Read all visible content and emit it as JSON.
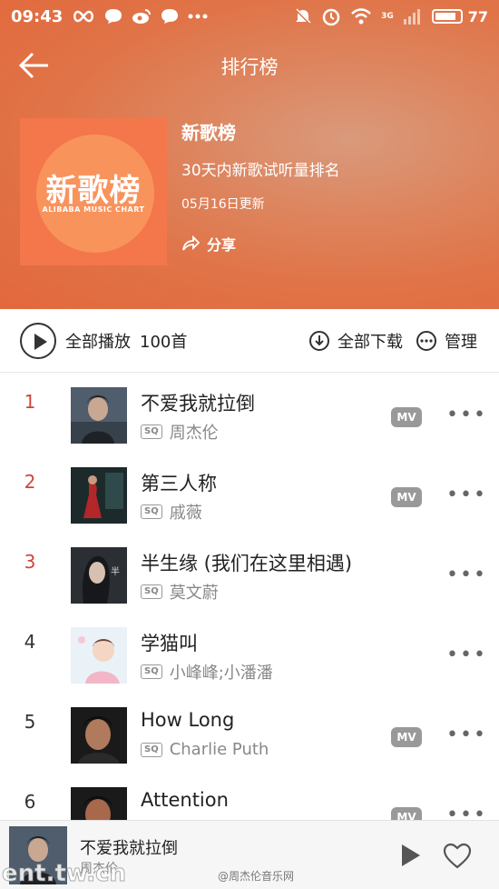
{
  "status_bar": {
    "time": "09:43",
    "battery": "77",
    "network": "3G",
    "icons_left": [
      "infinity-icon",
      "chat-bubble-icon",
      "weibo-icon",
      "chat-bubble-icon",
      "more-dots-icon"
    ],
    "icons_right": [
      "mute-icon",
      "alarm-icon",
      "wifi-icon",
      "signal-icon",
      "battery-icon"
    ]
  },
  "navbar": {
    "title": "排行榜",
    "back_icon": "back-arrow-icon"
  },
  "chart_header": {
    "cover_title": "新歌榜",
    "cover_subtitle": "ALIBABA MUSIC CHART",
    "title": "新歌榜",
    "description": "30天内新歌试听量排名",
    "updated": "05月16日更新",
    "share_label": "分享",
    "accent_color": "#e2683c"
  },
  "toolbar": {
    "play_all_label": "全部播放",
    "count_label": "100首",
    "download_all_label": "全部下载",
    "manage_label": "管理"
  },
  "songs": [
    {
      "rank": "1",
      "title": "不爱我就拉倒",
      "artist": "周杰伦",
      "quality": "SQ",
      "mv": "MV"
    },
    {
      "rank": "2",
      "title": "第三人称",
      "artist": "戚薇",
      "quality": "SQ",
      "mv": "MV"
    },
    {
      "rank": "3",
      "title": "半生缘 (我们在这里相遇)",
      "artist": "莫文蔚",
      "quality": "SQ"
    },
    {
      "rank": "4",
      "title": "学猫叫",
      "artist": "小峰峰;小潘潘",
      "quality": "SQ"
    },
    {
      "rank": "5",
      "title": "How Long",
      "artist": "Charlie Puth",
      "quality": "SQ",
      "mv": "MV"
    },
    {
      "rank": "6",
      "title": "Attention",
      "mv": "MV"
    }
  ],
  "player": {
    "title": "不爱我就拉倒",
    "artist": "周杰伦"
  },
  "watermarks": {
    "left": "ent.tw.cn",
    "right": "@周杰伦音乐网"
  },
  "colors": {
    "rank_top": "#d0453b",
    "rank_normal": "#333333",
    "mv_badge": "#999999"
  }
}
